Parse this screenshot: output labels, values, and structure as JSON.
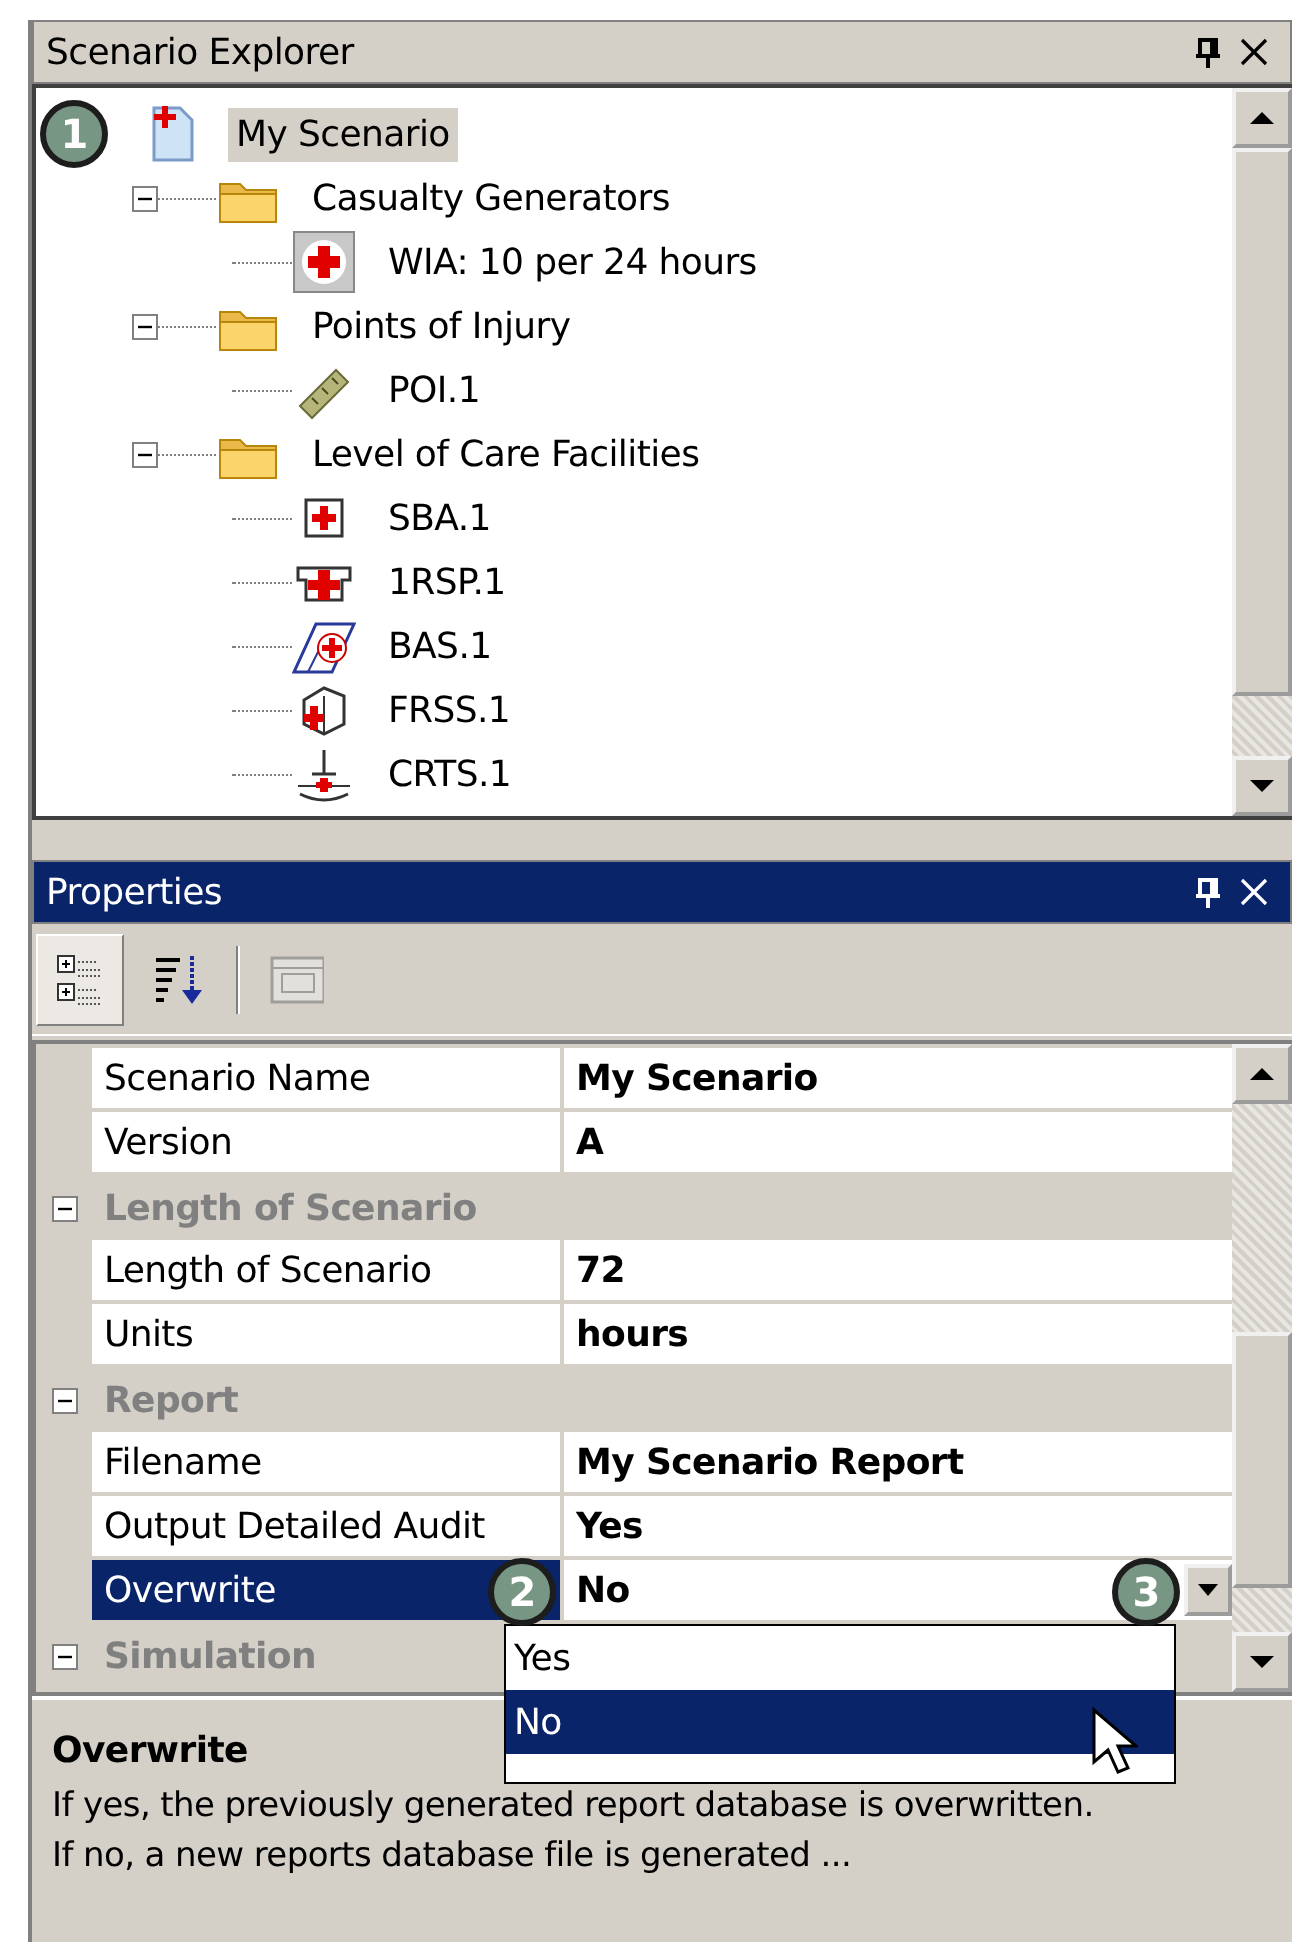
{
  "explorer": {
    "title": "Scenario Explorer",
    "active": false,
    "tree": [
      {
        "label": "My Scenario",
        "kind": "scenario",
        "selected": true,
        "callout": "1",
        "children": [
          {
            "label": "Casualty Generators",
            "kind": "folder",
            "selected": false,
            "expanded": true,
            "children": [
              {
                "label": "WIA: 10 per 24 hours",
                "kind": "casualty",
                "selected": false
              }
            ]
          },
          {
            "label": "Points of Injury",
            "kind": "folder",
            "selected": false,
            "expanded": true,
            "children": [
              {
                "label": "POI.1",
                "kind": "poi",
                "selected": false
              }
            ]
          },
          {
            "label": "Level of Care Facilities",
            "kind": "folder",
            "selected": false,
            "expanded": true,
            "children": [
              {
                "label": "SBA.1",
                "kind": "sba",
                "selected": false
              },
              {
                "label": "1RSP.1",
                "kind": "rsp",
                "selected": false
              },
              {
                "label": "BAS.1",
                "kind": "bas",
                "selected": false
              },
              {
                "label": "FRSS.1",
                "kind": "frss",
                "selected": false
              },
              {
                "label": "CRTS.1",
                "kind": "crts",
                "selected": false
              }
            ]
          }
        ]
      }
    ]
  },
  "properties": {
    "title": "Properties",
    "active": true,
    "toolbar": [
      {
        "kind": "categorized",
        "selected": true,
        "disabled": false
      },
      {
        "kind": "alphabetical",
        "selected": false,
        "disabled": false
      },
      {
        "kind": "pages",
        "selected": false,
        "disabled": true
      }
    ],
    "grid": [
      {
        "kind": "property",
        "name": "Scenario Name",
        "value": "My Scenario",
        "selected": false
      },
      {
        "kind": "property",
        "name": "Version",
        "value": "A",
        "selected": false
      },
      {
        "kind": "category",
        "name": "Length of Scenario",
        "expanded": true
      },
      {
        "kind": "property",
        "name": "Length of Scenario",
        "value": "72",
        "selected": false
      },
      {
        "kind": "property",
        "name": "Units",
        "value": "hours",
        "selected": false
      },
      {
        "kind": "category",
        "name": "Report",
        "expanded": true
      },
      {
        "kind": "property",
        "name": "Filename",
        "value": "My Scenario Report",
        "selected": false
      },
      {
        "kind": "property",
        "name": "Output Detailed Audit",
        "value": "Yes",
        "selected": false
      },
      {
        "kind": "property",
        "name": "Overwrite",
        "value": "No",
        "selected": true,
        "callout": "2",
        "dropdown": {
          "callout": "3",
          "options": [
            {
              "label": "Yes",
              "selected": false
            },
            {
              "label": "No",
              "selected": true
            }
          ]
        }
      },
      {
        "kind": "category",
        "name": "Simulation",
        "expanded": true
      }
    ],
    "description": {
      "title": "Overwrite",
      "text": "If yes, the previously generated report database is overwritten. If no, a new reports database file is generated ..."
    }
  }
}
